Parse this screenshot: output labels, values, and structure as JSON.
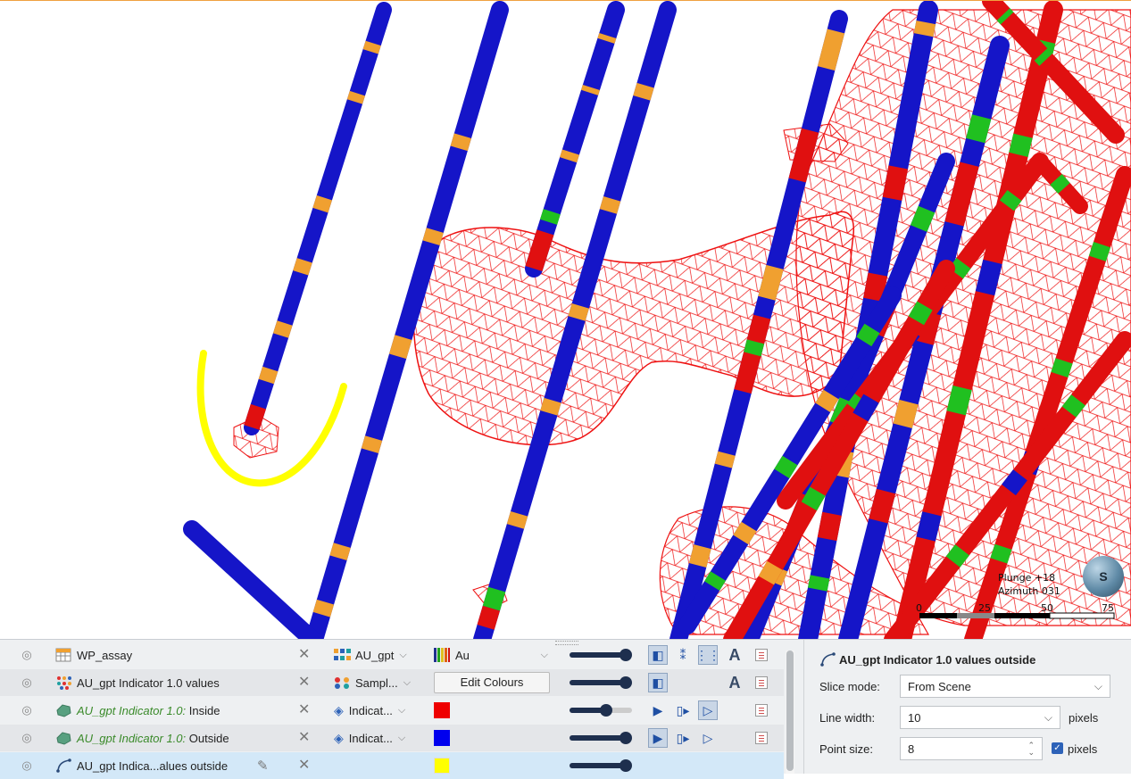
{
  "scene": {
    "plunge": "Plunge +18",
    "azimuth": "Azimuth 031",
    "scale_labels": [
      "0",
      "25",
      "50",
      "75"
    ],
    "compass_label": "S",
    "colors": {
      "hole": "#1515c8",
      "hole_hi": "#2a2ae0",
      "orange": "#f0a030",
      "red": "#e01010",
      "green": "#20c020",
      "mesh": "#ee1111",
      "yellow": "#ffff00"
    }
  },
  "objects": [
    {
      "name": "WP_assay",
      "attr": "AU_gpt",
      "colour_label": "Au",
      "slider": 0.95,
      "icon": "table-icon"
    },
    {
      "name": "AU_gpt Indicator 1.0 values",
      "attr": "Sampl...",
      "colour_button": "Edit Colours",
      "slider": 0.95,
      "icon": "points-icon"
    },
    {
      "name_italic": "AU_gpt Indicator 1.0:",
      "name_suffix": " Inside",
      "attr": "Indicat...",
      "swatch": "#ee0000",
      "slider": 0.6,
      "icon": "volume-icon"
    },
    {
      "name_italic": "AU_gpt Indicator 1.0:",
      "name_suffix": " Outside",
      "attr": "Indicat...",
      "swatch": "#0000ee",
      "slider": 0.95,
      "icon": "volume-icon"
    },
    {
      "name": "AU_gpt Indica...alues outside",
      "swatch": "#ffff00",
      "slider": 0.95,
      "icon": "polyline-icon"
    }
  ],
  "props": {
    "title": "AU_gpt Indicator 1.0 values outside",
    "slice_label": "Slice mode:",
    "slice_value": "From Scene",
    "line_label": "Line width:",
    "line_value": "10",
    "line_unit": "pixels",
    "point_label": "Point size:",
    "point_value": "8",
    "point_unit": "pixels"
  }
}
